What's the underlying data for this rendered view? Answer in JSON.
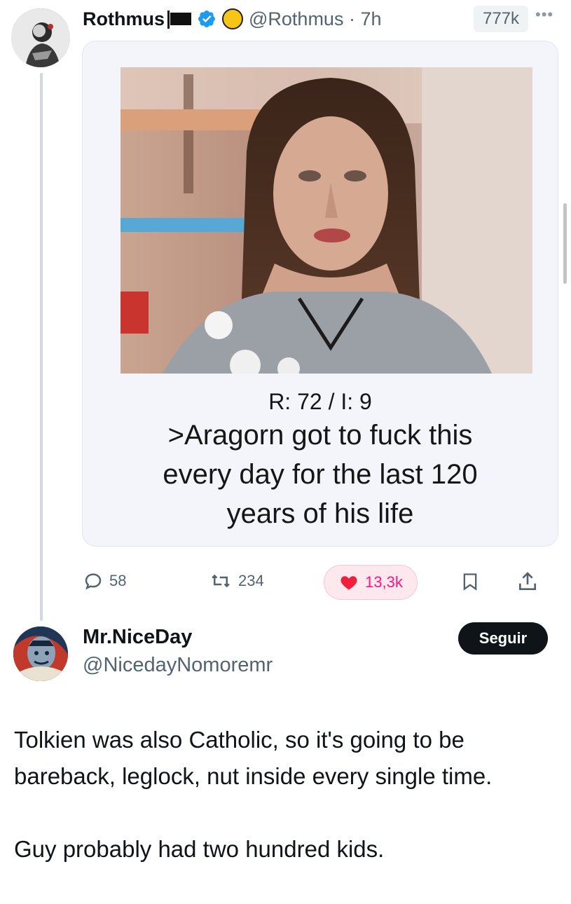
{
  "tweet": {
    "author_name": "Rothmus",
    "handle": "@Rothmus",
    "time": "7h",
    "views": "777k",
    "image_caption": {
      "meta": "R: 72 / I: 9",
      "lines": [
        ">Aragorn got to fuck this",
        "every day for the last 120",
        "years of his life"
      ]
    },
    "actions": {
      "replies": "58",
      "retweets": "234",
      "likes": "13,3k"
    }
  },
  "reply": {
    "author_name": "Mr.NiceDay",
    "handle": "@NicedayNomoremr",
    "follow_label": "Seguir",
    "paragraphs": [
      "Tolkien was also Catholic, so it's going to be bareback, leglock, nut inside every single time.",
      "Guy probably had two hundred kids."
    ]
  },
  "colors": {
    "like_accent": "#f91880",
    "verified_blue": "#1d9bf0",
    "follow_button": "#0f1419"
  }
}
